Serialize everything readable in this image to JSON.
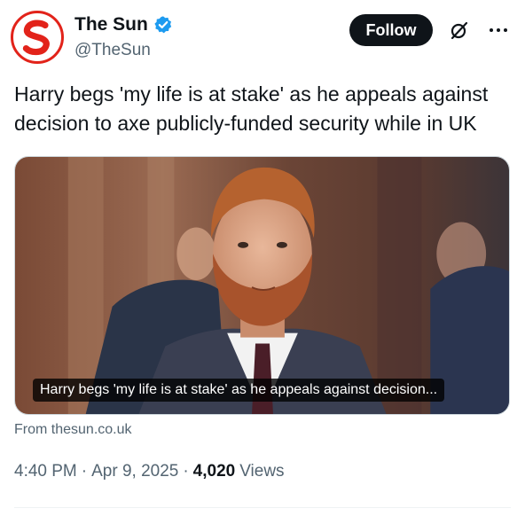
{
  "author": {
    "display_name": "The Sun",
    "handle": "@TheSun",
    "verified": true,
    "avatar_icon": "the-sun-logo-icon",
    "brand_color": "#e2231a"
  },
  "actions": {
    "follow_label": "Follow",
    "grok_icon": "grok-icon",
    "more_icon": "more-icon"
  },
  "tweet": {
    "text": "Harry begs 'my life is at stake' as he appeals against decision to axe publicly-funded security while in UK"
  },
  "card": {
    "caption": "Harry begs 'my life is at stake' as he appeals against decision...",
    "source": "From thesun.co.uk"
  },
  "meta": {
    "time": "4:40 PM",
    "date": "Apr 9, 2025",
    "views_count": "4,020",
    "views_label": "Views"
  },
  "colors": {
    "text_primary": "#0f1419",
    "text_secondary": "#536471",
    "verified_blue": "#1d9bf0"
  }
}
